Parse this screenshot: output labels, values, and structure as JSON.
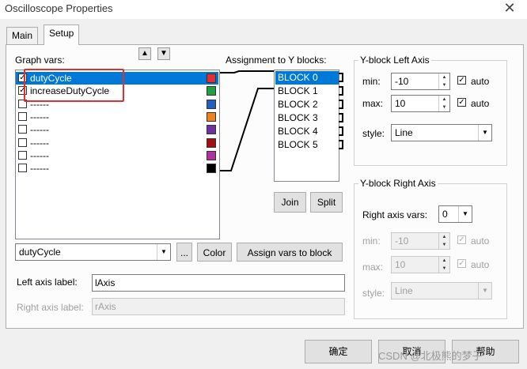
{
  "window": {
    "title": "Oscilloscope Properties",
    "close_glyph": "✕"
  },
  "tabs": [
    {
      "label": "Main",
      "active": false
    },
    {
      "label": "Setup",
      "active": true
    }
  ],
  "graph_vars": {
    "label": "Graph vars:",
    "items": [
      {
        "name": "dutyCycle",
        "checked": true,
        "color": "#e03030",
        "selected": true
      },
      {
        "name": "increaseDutyCycle",
        "checked": true,
        "color": "#20a040",
        "selected": false
      },
      {
        "name": "------",
        "checked": false,
        "color": "#2060c0",
        "selected": false
      },
      {
        "name": "------",
        "checked": false,
        "color": "#f08020",
        "selected": false
      },
      {
        "name": "------",
        "checked": false,
        "color": "#7030a0",
        "selected": false
      },
      {
        "name": "------",
        "checked": false,
        "color": "#a01010",
        "selected": false
      },
      {
        "name": "------",
        "checked": false,
        "color": "#b030a0",
        "selected": false
      },
      {
        "name": "------",
        "checked": false,
        "color": "#000000",
        "selected": false
      }
    ],
    "up_glyph": "▲",
    "down_glyph": "▼"
  },
  "assignment": {
    "label": "Assignment to Y blocks:",
    "blocks": [
      "BLOCK 0",
      "BLOCK 1",
      "BLOCK 2",
      "BLOCK 3",
      "BLOCK 4",
      "BLOCK 5"
    ],
    "join_label": "Join",
    "split_label": "Split"
  },
  "var_select": {
    "value": "dutyCycle",
    "browse_label": "...",
    "color_label": "Color",
    "assign_label": "Assign vars to block"
  },
  "axis_labels": {
    "left_label": "Left axis label:",
    "left_value": "lAxis",
    "right_label": "Right axis label:",
    "right_value": "rAxis"
  },
  "left_axis": {
    "title": "Y-block Left Axis",
    "min_label": "min:",
    "min_value": "-10",
    "max_label": "max:",
    "max_value": "10",
    "auto_label": "auto",
    "style_label": "style:",
    "style_value": "Line"
  },
  "right_axis": {
    "title": "Y-block Right Axis",
    "vars_label": "Right axis vars:",
    "vars_value": "0",
    "min_label": "min:",
    "min_value": "-10",
    "max_label": "max:",
    "max_value": "10",
    "auto_label": "auto",
    "style_label": "style:",
    "style_value": "Line"
  },
  "footer": {
    "ok_label": "确定",
    "cancel_label": "取消",
    "help_label": "帮助"
  },
  "watermark": "CSDN @北极熊的梦子"
}
